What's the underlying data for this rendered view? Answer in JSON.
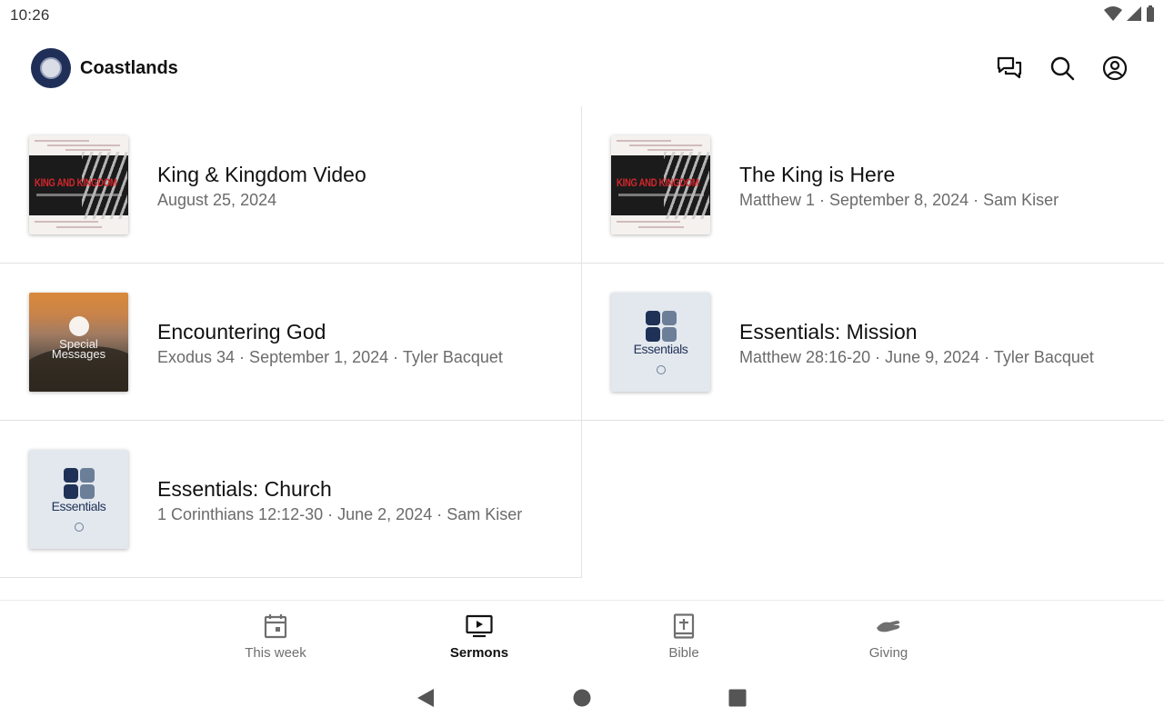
{
  "status_bar": {
    "time": "10:26"
  },
  "header": {
    "app_name": "Coastlands",
    "icons": [
      "chat-icon",
      "search-icon",
      "account-icon"
    ]
  },
  "sermons": [
    {
      "title": "King & Kingdom Video",
      "meta": "August 25, 2024",
      "thumb_text": "KING AND KINGDOM"
    },
    {
      "title": "The King is Here",
      "meta": "Matthew 1 · September 8, 2024 · Sam Kiser",
      "thumb_text": "KING AND KINGDOM"
    },
    {
      "title": "Encountering God",
      "meta": "Exodus 34 · September 1, 2024 · Tyler Bacquet",
      "thumb_text_1": "Special",
      "thumb_text_2": "Messages"
    },
    {
      "title": "Essentials: Mission",
      "meta": "Matthew 28:16-20 · June 9, 2024 · Tyler Bacquet",
      "thumb_text": "Essentials"
    },
    {
      "title": "Essentials: Church",
      "meta": "1 Corinthians 12:12-30 · June 2, 2024 · Sam Kiser",
      "thumb_text": "Essentials"
    }
  ],
  "bottom_nav": [
    {
      "label": "This week",
      "icon": "calendar-icon",
      "active": false
    },
    {
      "label": "Sermons",
      "icon": "tv-play-icon",
      "active": true
    },
    {
      "label": "Bible",
      "icon": "bible-icon",
      "active": false
    },
    {
      "label": "Giving",
      "icon": "giving-hand-icon",
      "active": false
    }
  ],
  "colors": {
    "brand_navy": "#1f2f58",
    "text_primary": "#111111",
    "text_secondary": "#6b6b6b",
    "king_red": "#d3272c"
  }
}
